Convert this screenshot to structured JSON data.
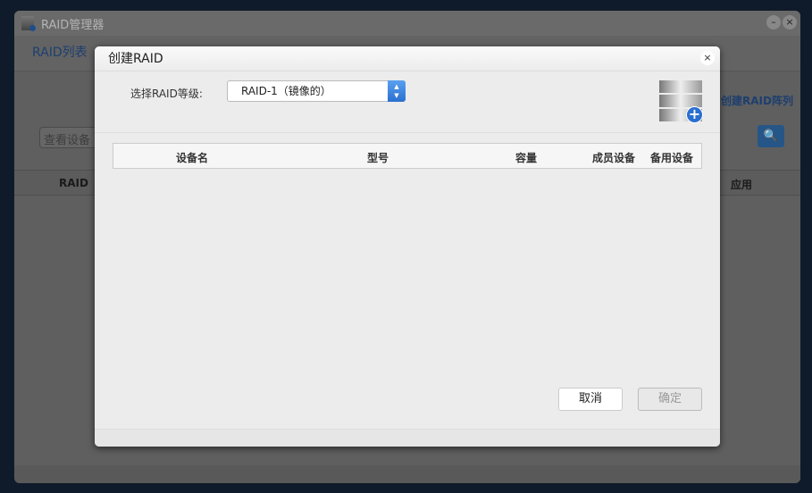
{
  "window": {
    "title": "RAID管理器",
    "minimize": "–",
    "close": "×"
  },
  "tabs": {
    "raid_list": "RAID列表"
  },
  "toolbar": {
    "create_array": "创建RAID阵列",
    "search_placeholder": "查看设备",
    "search_icon": "🔍"
  },
  "table": {
    "columns": [
      "RAID",
      "应用"
    ]
  },
  "dialog": {
    "title": "创建RAID",
    "close": "×",
    "level_label": "选择RAID等级:",
    "level_value": "RAID-1（镜像的）",
    "columns": [
      "设备名",
      "型号",
      "容量",
      "成员设备",
      "备用设备"
    ],
    "cancel": "取消",
    "ok": "确定"
  }
}
